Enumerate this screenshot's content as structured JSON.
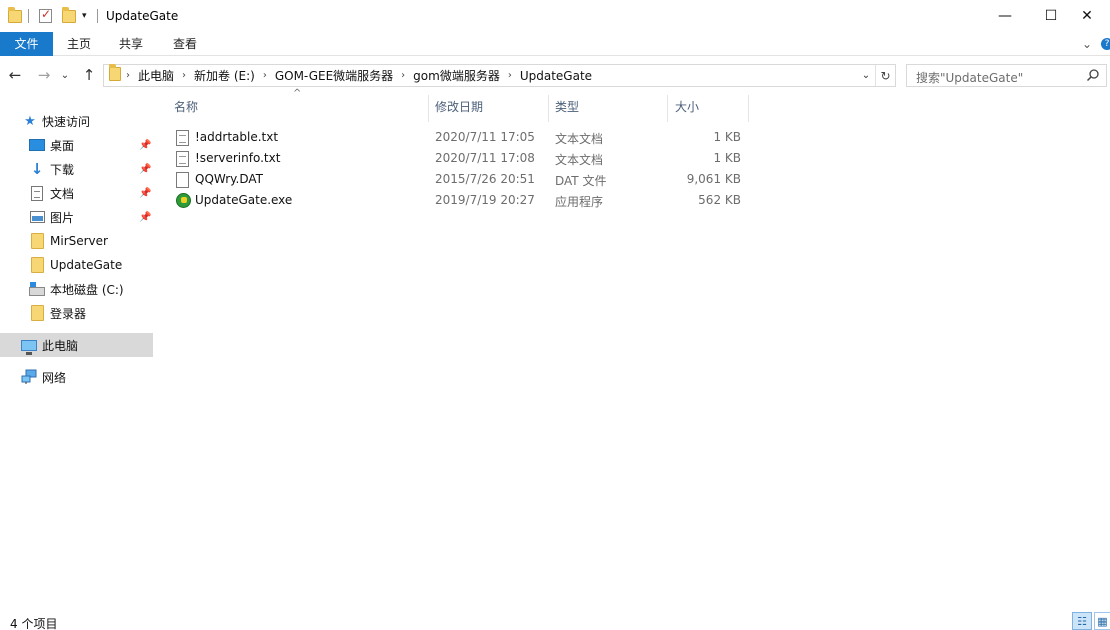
{
  "window": {
    "title": "UpdateGate",
    "minimize": "—",
    "maximize": "☐",
    "close": "✕"
  },
  "ribbon": {
    "tabs": [
      "文件",
      "主页",
      "共享",
      "查看"
    ],
    "collapse": "⌄",
    "help": "?"
  },
  "address": {
    "root_chevron": "›",
    "crumbs": [
      "此电脑",
      "新加卷 (E:)",
      "GOM-GEE微端服务器",
      "gom微端服务器",
      "UpdateGate"
    ],
    "dropdown": "⌄",
    "refresh": "↻"
  },
  "search": {
    "placeholder": "搜索\"UpdateGate\""
  },
  "nav": {
    "back": "←",
    "forward": "→",
    "recent": "⌄",
    "up": "↑"
  },
  "sidebar": {
    "quick_access": "快速访问",
    "items": [
      {
        "label": "桌面",
        "pinned": true
      },
      {
        "label": "下载",
        "pinned": true
      },
      {
        "label": "文档",
        "pinned": true
      },
      {
        "label": "图片",
        "pinned": true
      },
      {
        "label": "MirServer",
        "pinned": false
      },
      {
        "label": "UpdateGate",
        "pinned": false
      },
      {
        "label": "本地磁盘 (C:)",
        "pinned": false
      },
      {
        "label": "登录器",
        "pinned": false
      }
    ],
    "this_pc": "此电脑",
    "network": "网络",
    "pin_glyph": "📌"
  },
  "columns": {
    "name": "名称",
    "date": "修改日期",
    "type": "类型",
    "size": "大小",
    "sort_glyph": "^"
  },
  "files": [
    {
      "name": "!addrtable.txt",
      "date": "2020/7/11 17:05",
      "type": "文本文档",
      "size": "1 KB",
      "icon": "text-file-icon"
    },
    {
      "name": "!serverinfo.txt",
      "date": "2020/7/11 17:08",
      "type": "文本文档",
      "size": "1 KB",
      "icon": "text-file-icon"
    },
    {
      "name": "QQWry.DAT",
      "date": "2015/7/26 20:51",
      "type": "DAT 文件",
      "size": "9,061 KB",
      "icon": "blank-file-icon"
    },
    {
      "name": "UpdateGate.exe",
      "date": "2019/7/19 20:27",
      "type": "应用程序",
      "size": "562 KB",
      "icon": "exe-icon"
    }
  ],
  "status": {
    "count": "4 个项目",
    "details_view": "☷",
    "large_icon_view": "▦"
  }
}
